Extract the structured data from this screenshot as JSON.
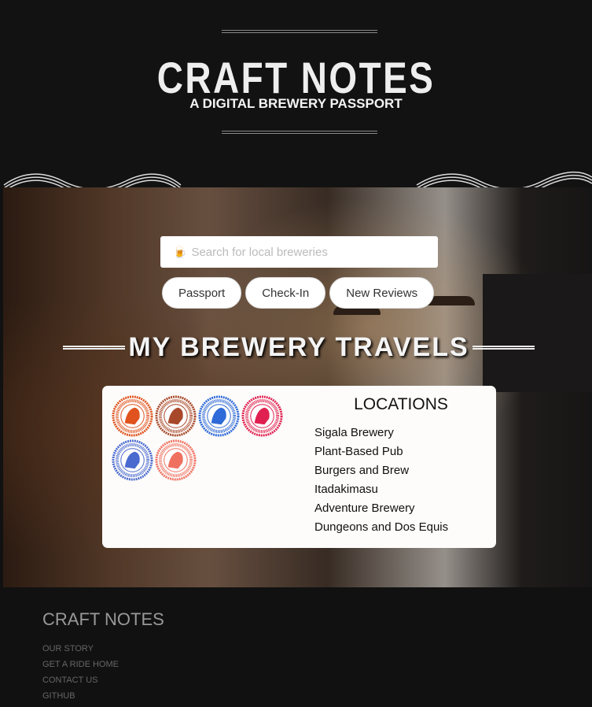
{
  "header": {
    "title": "CRAFT NOTES",
    "subtitle": "A DIGITAL BREWERY PASSPORT"
  },
  "search": {
    "placeholder": "Search for local breweries",
    "icon": "beer-mug-icon"
  },
  "nav": {
    "buttons": [
      "Passport",
      "Check-In",
      "New Reviews"
    ]
  },
  "section_title": "MY BREWERY TRAVELS",
  "stamps": {
    "colors": [
      "#e0531e",
      "#a8482a",
      "#2e6ad8",
      "#e02050",
      "#4a6ad0",
      "#f07060"
    ]
  },
  "locations": {
    "title": "LOCATIONS",
    "items": [
      "Sigala Brewery",
      "Plant-Based Pub",
      "Burgers and Brew",
      "Itadakimasu",
      "Adventure Brewery",
      "Dungeons and Dos Equis"
    ]
  },
  "footer": {
    "title": "CRAFT NOTES",
    "links": [
      "OUR STORY",
      "GET A RIDE HOME",
      "CONTACT US",
      "GITHUB"
    ]
  }
}
